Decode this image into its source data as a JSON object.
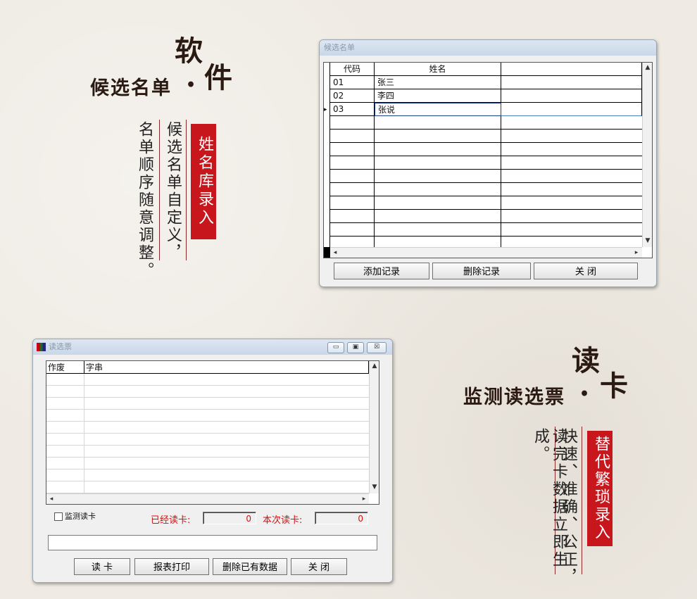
{
  "section1": {
    "heading_big": "软",
    "heading_line": "候选名单",
    "heading_dot": "•",
    "heading_big2": "件",
    "tag": "姓名库录入",
    "col1": "候选名单自定义，",
    "col2": "名单顺序随意调整。"
  },
  "win1": {
    "title": "候选名单",
    "columns": [
      "代码",
      "姓名"
    ],
    "rows": [
      {
        "code": "01",
        "name": "张三"
      },
      {
        "code": "02",
        "name": "李四"
      },
      {
        "code": "03",
        "name": "张说"
      }
    ],
    "buttons": {
      "add": "添加记录",
      "delete": "删除记录",
      "close": "关  闭"
    },
    "row_marker": "▸",
    "scroll_up": "▲",
    "scroll_down": "▼",
    "scroll_left": "◂",
    "scroll_right": "▸"
  },
  "section2": {
    "heading_big": "读",
    "heading_line": "监测读选票",
    "heading_dot": "•",
    "heading_big2": "卡",
    "tag": "替代繁琐录入",
    "col1": "快速、准确、公正，",
    "col2": "读完卡数据立即生成。"
  },
  "win2": {
    "title": "读选票",
    "columns": [
      "作废",
      "字串"
    ],
    "monitor_label": "监测读卡",
    "read_count_label": "已经读卡:",
    "read_count": "0",
    "this_read_label": "本次读卡:",
    "this_read": "0",
    "buttons": {
      "read": "读  卡",
      "print": "报表打印",
      "clear": "删除已有数据",
      "close": "关  闭"
    },
    "ctl_min": "▭",
    "ctl_max": "▣",
    "ctl_close": "☒"
  },
  "colors": {
    "accent_red": "#c8161d",
    "label_red": "#d21010"
  }
}
